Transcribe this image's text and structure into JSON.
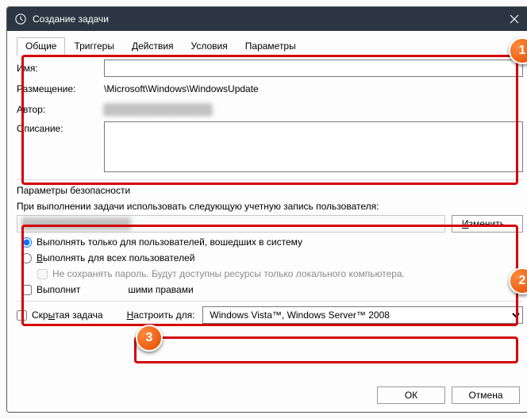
{
  "window": {
    "title": "Создание задачи"
  },
  "tabs": {
    "general": "Общие",
    "triggers": "Триггеры",
    "actions": "Действия",
    "conditions": "Условия",
    "params": "Параметры"
  },
  "fields": {
    "name_label": "Имя:",
    "name_value": "",
    "location_label": "Размещение:",
    "location_value": "\\Microsoft\\Windows\\WindowsUpdate",
    "author_label": "Автор:",
    "author_value": "████████████████",
    "description_label": "Описание:",
    "description_value": ""
  },
  "security": {
    "section_title": "Параметры безопасности",
    "use_account_label": "При выполнении задачи использовать следующую учетную запись пользователя:",
    "account_value": "████████████████",
    "change_btn": "Изменить...",
    "radio_loggedin": "Выполнять только для пользователей, вошедших в систему",
    "radio_all": "Выполнять для всех пользователей",
    "dont_save_pwd": "Не сохранять пароль. Будут доступны ресурсы только локального компьютера.",
    "run_highest": "Выполнить с наивысшими правами"
  },
  "bottom": {
    "hidden_task": "Скрытая задача",
    "configure_for_label": "Настроить для:",
    "configure_for_value": "Windows Vista™, Windows Server™ 2008"
  },
  "buttons": {
    "ok": "ОК",
    "cancel": "Отмена"
  },
  "badges": {
    "one": "1",
    "two": "2",
    "three": "3"
  }
}
